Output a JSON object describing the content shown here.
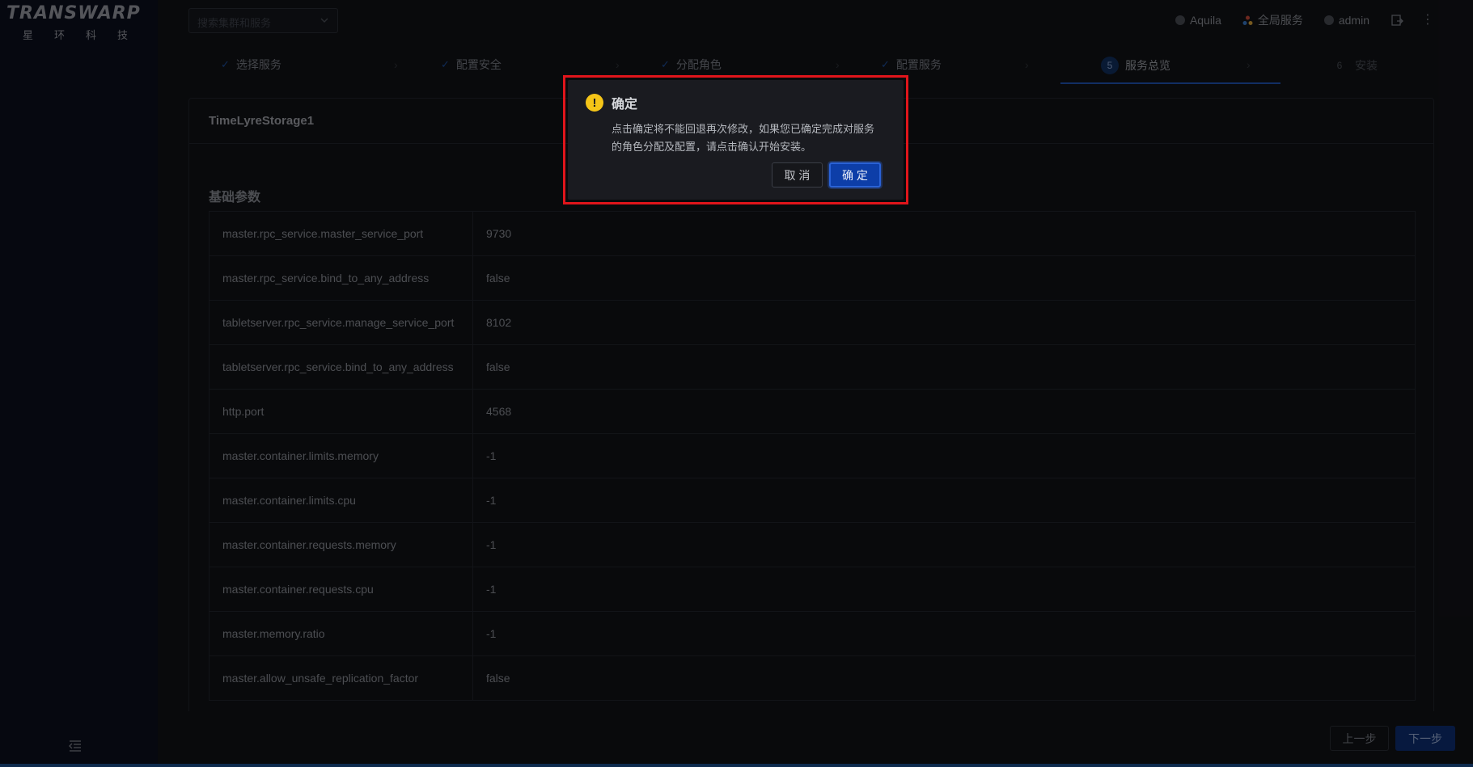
{
  "brand": {
    "logo_text": "TRANSWARP",
    "sub": [
      "星",
      "环",
      "科",
      "技"
    ]
  },
  "topbar": {
    "search_placeholder": "搜索集群和服务",
    "items": [
      {
        "icon": "cluster-icon",
        "label": "Aquila"
      },
      {
        "icon": "global-services-icon",
        "label": "全局服务"
      },
      {
        "icon": "user-icon",
        "label": "admin"
      }
    ],
    "more_icon": "more-vertical-icon"
  },
  "steps": [
    {
      "label": "选择服务",
      "state": "done"
    },
    {
      "label": "配置安全",
      "state": "done"
    },
    {
      "label": "分配角色",
      "state": "done"
    },
    {
      "label": "配置服务",
      "state": "done"
    },
    {
      "number": "5",
      "label": "服务总览",
      "state": "active"
    },
    {
      "number": "6",
      "label": "安装",
      "state": "pending"
    }
  ],
  "card": {
    "title": "TimeLyreStorage1",
    "section": "基础参数"
  },
  "params": [
    {
      "key": "master.rpc_service.master_service_port",
      "value": "9730"
    },
    {
      "key": "master.rpc_service.bind_to_any_address",
      "value": "false"
    },
    {
      "key": "tabletserver.rpc_service.manage_service_port",
      "value": "8102"
    },
    {
      "key": "tabletserver.rpc_service.bind_to_any_address",
      "value": "false"
    },
    {
      "key": "http.port",
      "value": "4568"
    },
    {
      "key": "master.container.limits.memory",
      "value": "-1"
    },
    {
      "key": "master.container.limits.cpu",
      "value": "-1"
    },
    {
      "key": "master.container.requests.memory",
      "value": "-1"
    },
    {
      "key": "master.container.requests.cpu",
      "value": "-1"
    },
    {
      "key": "master.memory.ratio",
      "value": "-1"
    },
    {
      "key": "master.allow_unsafe_replication_factor",
      "value": "false"
    }
  ],
  "footer": {
    "prev": "上一步",
    "next": "下一步"
  },
  "modal": {
    "title": "确定",
    "body": "点击确定将不能回退再次修改，如果您已确定完成对服务的角色分配及配置，请点击确认开始安装。",
    "cancel": "取 消",
    "ok": "确 定"
  }
}
